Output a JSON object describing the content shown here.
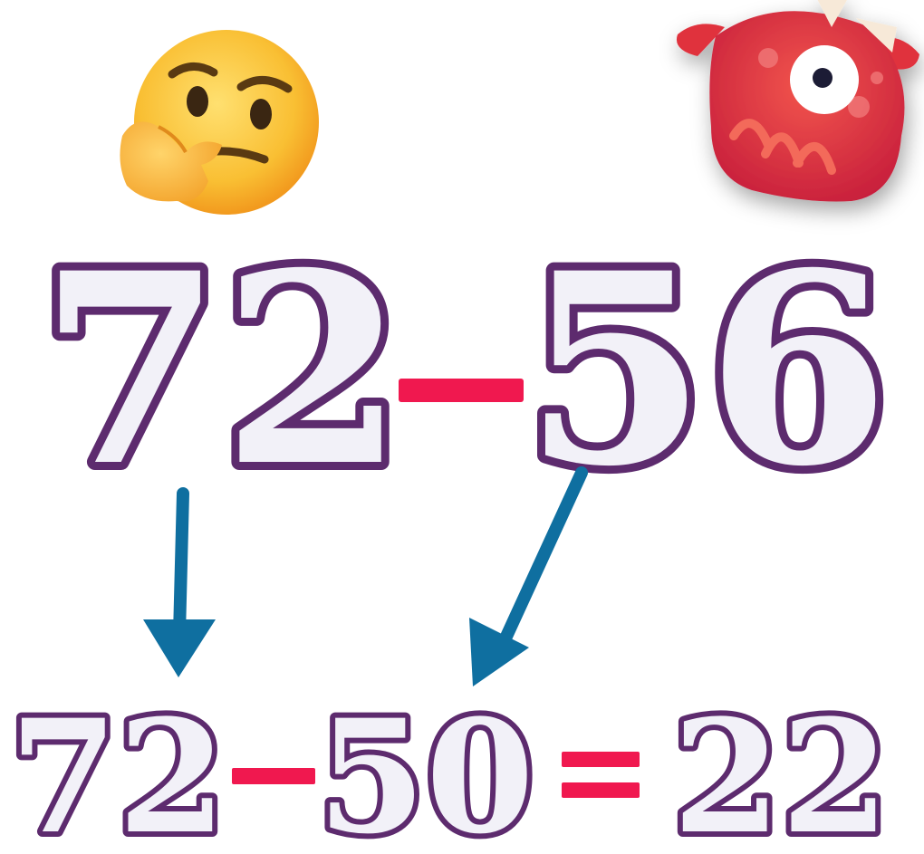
{
  "problem": {
    "minuend": "72",
    "subtrahend": "56"
  },
  "solution": {
    "minuend": "72",
    "rounded_subtrahend": "50",
    "result": "22"
  },
  "icons": {
    "thinking": "thinking-face-icon",
    "monster": "red-monster-icon"
  },
  "colors": {
    "digit_fill": "#f2f1f8",
    "digit_outline": "#5d2b6e",
    "operator": "#f0184f",
    "arrow": "#0f6fa0",
    "monster_body": "#e0303c",
    "emoji_face": "#f9bf33"
  }
}
